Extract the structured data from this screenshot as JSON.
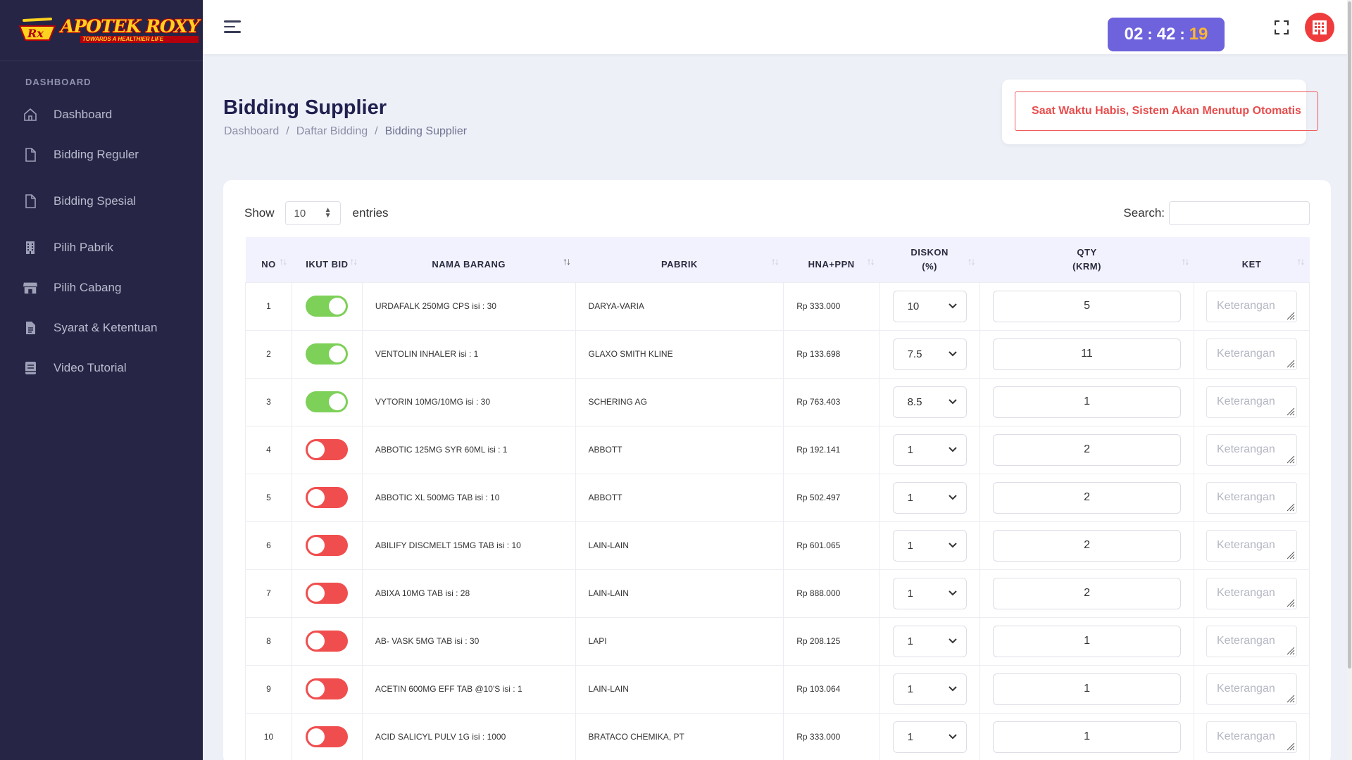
{
  "brand": {
    "title": "APOTEK ROXY",
    "tagline": "TOWARDS A HEALTHIER LIFE"
  },
  "sidebar": {
    "section": "DASHBOARD",
    "items": [
      {
        "label": "Dashboard",
        "icon": "home-icon"
      },
      {
        "label": "Bidding Reguler",
        "icon": "document-icon"
      },
      {
        "label": "Bidding Spesial",
        "icon": "document-icon"
      },
      {
        "label": "Pilih Pabrik",
        "icon": "building-icon"
      },
      {
        "label": "Pilih Cabang",
        "icon": "store-icon"
      },
      {
        "label": "Syarat & Ketentuan",
        "icon": "file-text-icon"
      },
      {
        "label": "Video Tutorial",
        "icon": "book-icon"
      }
    ]
  },
  "timer": {
    "hours": "02",
    "minutes": "42",
    "seconds": "19",
    "sep": ":"
  },
  "page": {
    "title": "Bidding Supplier",
    "breadcrumb": [
      "Dashboard",
      "Daftar Bidding",
      "Bidding Supplier"
    ],
    "breadcrumb_sep": "/",
    "notice": "Saat Waktu Habis, Sistem Akan Menutup Otomatis"
  },
  "table_controls": {
    "show_label": "Show",
    "page_length": "10",
    "entries_label": "entries",
    "search_label": "Search:"
  },
  "columns": [
    "NO",
    "IKUT BID",
    "NAMA BARANG",
    "PABRIK",
    "HNA+PPN",
    "DISKON\n(%)",
    "QTY\n(KRM)",
    "KET"
  ],
  "ket_placeholder": "Keterangan",
  "rows": [
    {
      "no": "1",
      "bid": true,
      "nama": "URDAFALK 250MG CPS isi : 30",
      "pabrik": "DARYA-VARIA",
      "hna": "Rp 333.000",
      "diskon": "10",
      "qty": "5"
    },
    {
      "no": "2",
      "bid": true,
      "nama": "VENTOLIN INHALER isi : 1",
      "pabrik": "GLAXO SMITH KLINE",
      "hna": "Rp 133.698",
      "diskon": "7.5",
      "qty": "11"
    },
    {
      "no": "3",
      "bid": true,
      "nama": "VYTORIN 10MG/10MG isi : 30",
      "pabrik": "SCHERING AG",
      "hna": "Rp 763.403",
      "diskon": "8.5",
      "qty": "1"
    },
    {
      "no": "4",
      "bid": false,
      "nama": "ABBOTIC 125MG SYR 60ML isi : 1",
      "pabrik": "ABBOTT",
      "hna": "Rp 192.141",
      "diskon": "1",
      "qty": "2"
    },
    {
      "no": "5",
      "bid": false,
      "nama": "ABBOTIC XL 500MG TAB isi : 10",
      "pabrik": "ABBOTT",
      "hna": "Rp 502.497",
      "diskon": "1",
      "qty": "2"
    },
    {
      "no": "6",
      "bid": false,
      "nama": "ABILIFY DISCMELT 15MG TAB isi : 10",
      "pabrik": "LAIN-LAIN",
      "hna": "Rp 601.065",
      "diskon": "1",
      "qty": "2"
    },
    {
      "no": "7",
      "bid": false,
      "nama": "ABIXA 10MG TAB isi : 28",
      "pabrik": "LAIN-LAIN",
      "hna": "Rp 888.000",
      "diskon": "1",
      "qty": "2"
    },
    {
      "no": "8",
      "bid": false,
      "nama": "AB- VASK 5MG TAB isi : 30",
      "pabrik": "LAPI",
      "hna": "Rp 208.125",
      "diskon": "1",
      "qty": "1"
    },
    {
      "no": "9",
      "bid": false,
      "nama": "ACETIN 600MG EFF TAB @10'S isi : 1",
      "pabrik": "LAIN-LAIN",
      "hna": "Rp 103.064",
      "diskon": "1",
      "qty": "1"
    },
    {
      "no": "10",
      "bid": false,
      "nama": "ACID SALICYL PULV 1G isi : 1000",
      "pabrik": "BRATACO CHEMIKA, PT",
      "hna": "Rp 333.000",
      "diskon": "1",
      "qty": "1"
    }
  ],
  "colors": {
    "sidebar": "#262545",
    "timer": "#6e63dc",
    "toggle_on": "#7dd058",
    "toggle_off": "#f04e4e",
    "notice": "#e84c4c"
  }
}
